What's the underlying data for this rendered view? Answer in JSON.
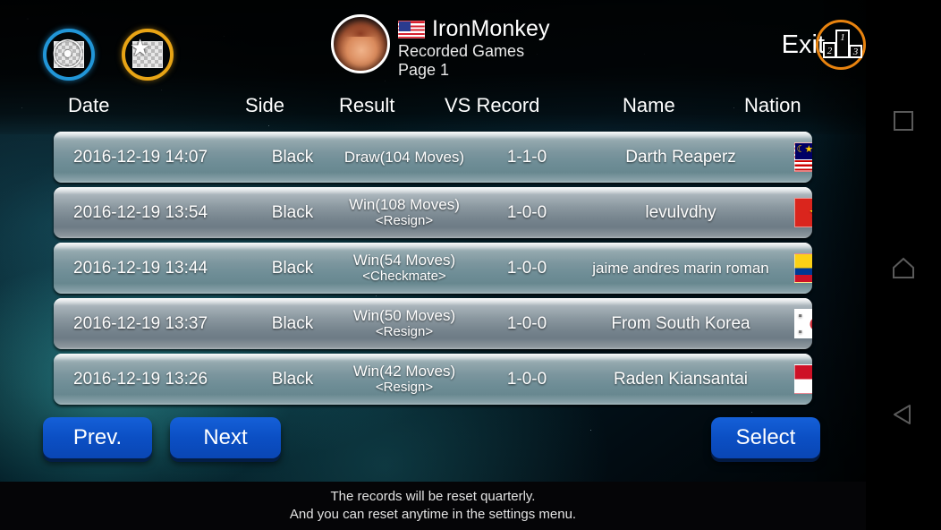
{
  "header": {
    "online_button_icon": "globe-checker-icon",
    "local_button_icon": "star-checker-icon",
    "username": "IronMonkey",
    "user_flag": "flag-us",
    "subtitle": "Recorded Games",
    "page_label": "Page 1",
    "exit_label": "Exit",
    "exit_icon": "podium-icon",
    "podium": {
      "first": "1",
      "second": "2",
      "third": "3"
    }
  },
  "table": {
    "columns": [
      "Date",
      "Side",
      "Result",
      "VS Record",
      "Name",
      "Nation"
    ],
    "rows": [
      {
        "date": "2016-12-19 14:07",
        "side": "Black",
        "result_main": "Draw(104 Moves)",
        "result_sub": "",
        "vs_record": "1-1-0",
        "name": "Darth Reaperz",
        "nation": "Malaysia",
        "flag": "flag-my"
      },
      {
        "date": "2016-12-19 13:54",
        "side": "Black",
        "result_main": "Win(108 Moves)",
        "result_sub": "<Resign>",
        "vs_record": "1-0-0",
        "name": "levulvdhy",
        "nation": "Vietnam",
        "flag": "flag-vn"
      },
      {
        "date": "2016-12-19 13:44",
        "side": "Black",
        "result_main": "Win(54 Moves)",
        "result_sub": "<Checkmate>",
        "vs_record": "1-0-0",
        "name": "jaime andres marin roman",
        "nation": "Colombia",
        "flag": "flag-co"
      },
      {
        "date": "2016-12-19 13:37",
        "side": "Black",
        "result_main": "Win(50 Moves)",
        "result_sub": "<Resign>",
        "vs_record": "1-0-0",
        "name": "From South Korea",
        "nation": "South Korea",
        "flag": "flag-kr"
      },
      {
        "date": "2016-12-19 13:26",
        "side": "Black",
        "result_main": "Win(42 Moves)",
        "result_sub": "<Resign>",
        "vs_record": "1-0-0",
        "name": "Raden Kiansantai",
        "nation": "Indonesia",
        "flag": "flag-id"
      }
    ]
  },
  "buttons": {
    "prev": "Prev.",
    "next": "Next",
    "select": "Select"
  },
  "footer": {
    "line1": "The records will be reset quarterly.",
    "line2": "And you can reset anytime in the settings menu."
  },
  "navbar": {
    "recent": "recent-apps-icon",
    "home": "home-icon",
    "back": "back-icon"
  },
  "colors": {
    "accent_blue": "#1560d8",
    "accent_orange": "#e8830f",
    "ring_blue": "#2196d8",
    "ring_orange": "#e8a415",
    "background": "#03222c"
  }
}
